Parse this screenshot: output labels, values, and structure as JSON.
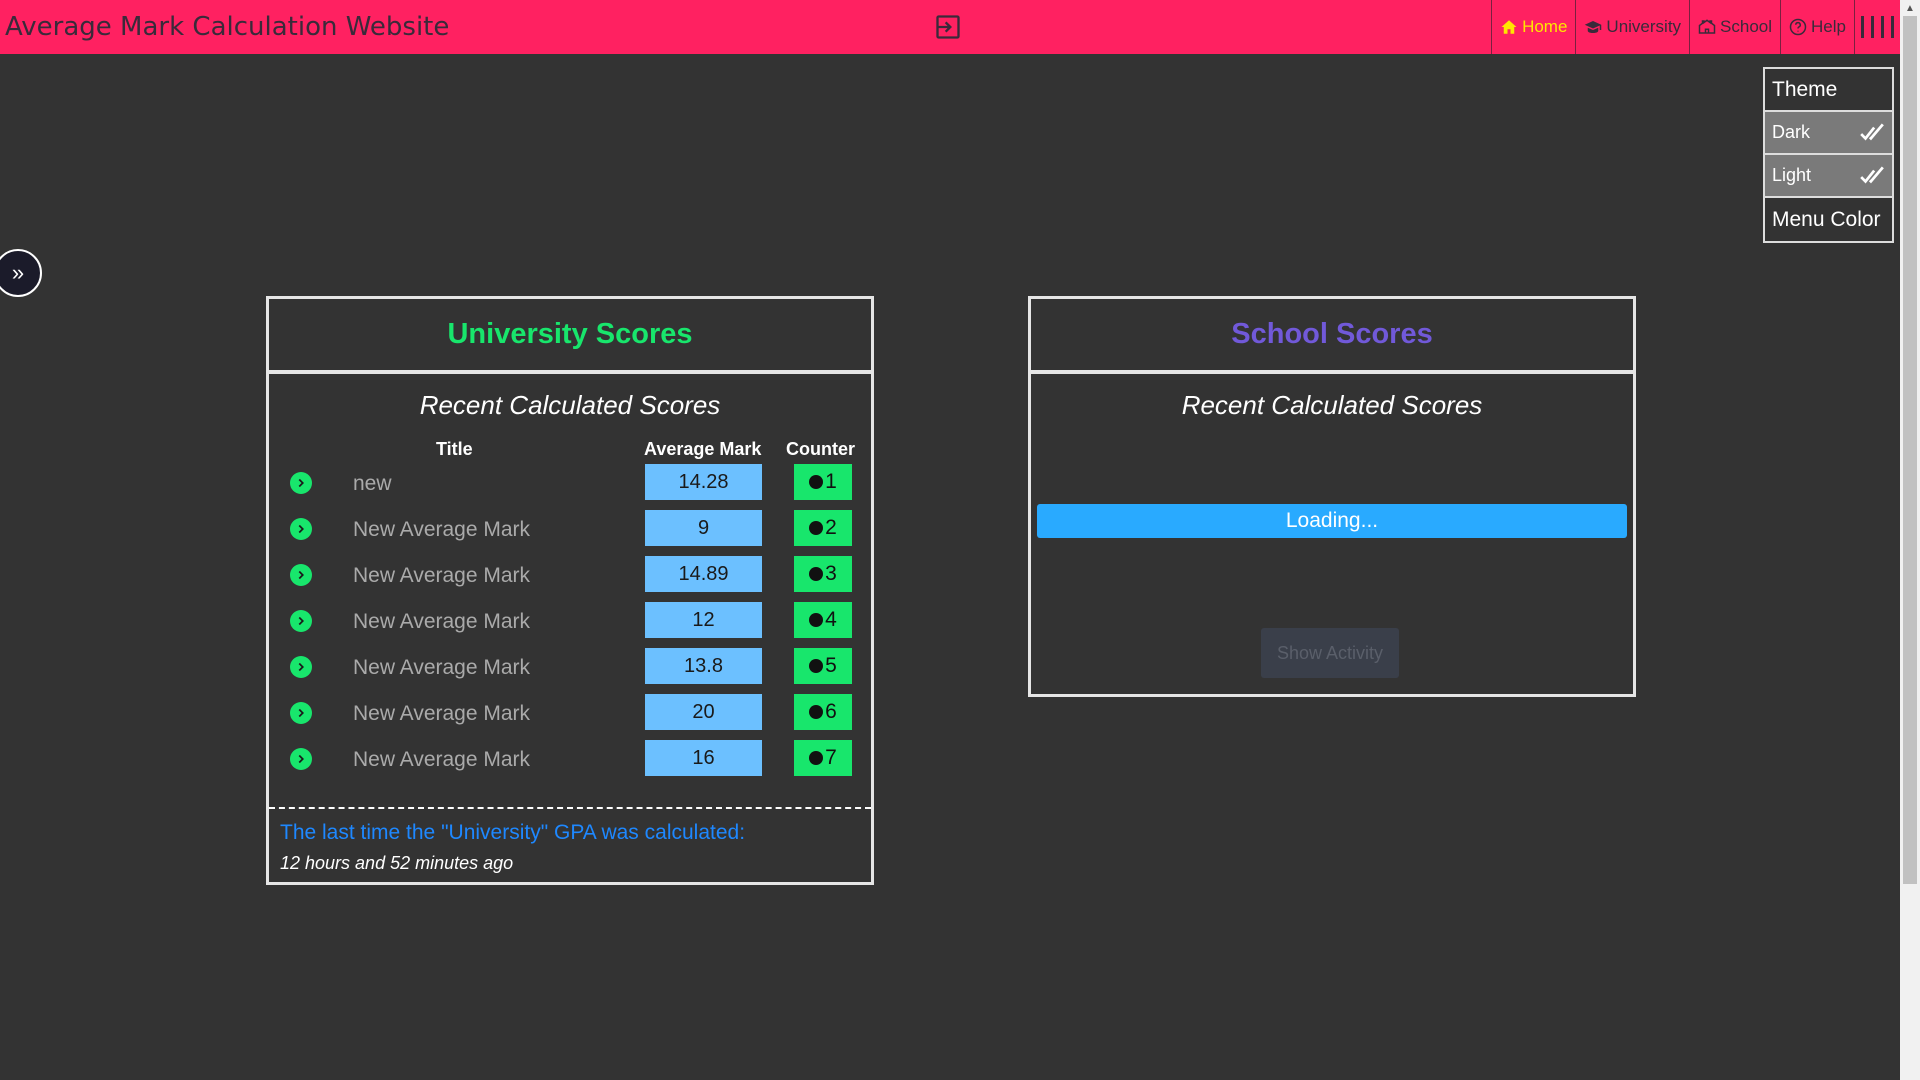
{
  "header": {
    "title": "Average Mark Calculation Website",
    "nav": [
      {
        "label": "Home",
        "icon": "home-icon",
        "active": true
      },
      {
        "label": "University",
        "icon": "graduation-cap-icon"
      },
      {
        "label": "School",
        "icon": "school-icon"
      },
      {
        "label": "Help",
        "icon": "help-icon"
      }
    ]
  },
  "theme_menu": {
    "title": "Theme",
    "options": [
      "Dark",
      "Light"
    ],
    "menu_color": "Menu Color"
  },
  "university": {
    "heading": "University Scores",
    "subtitle": "Recent Calculated Scores",
    "columns": {
      "title": "Title",
      "average": "Average Mark",
      "counter": "Counter"
    },
    "rows": [
      {
        "title": "new",
        "average": "14.28",
        "counter": "1"
      },
      {
        "title": "New Average Mark",
        "average": "9",
        "counter": "2"
      },
      {
        "title": "New Average Mark",
        "average": "14.89",
        "counter": "3"
      },
      {
        "title": "New Average Mark",
        "average": "12",
        "counter": "4"
      },
      {
        "title": "New Average Mark",
        "average": "13.8",
        "counter": "5"
      },
      {
        "title": "New Average Mark",
        "average": "20",
        "counter": "6"
      },
      {
        "title": "New Average Mark",
        "average": "16",
        "counter": "7"
      }
    ],
    "last_calc_label": "The last time the \"University\" GPA was calculated:",
    "last_calc_time": "12 hours and 52 minutes ago"
  },
  "school": {
    "heading": "School Scores",
    "subtitle": "Recent Calculated Scores",
    "loading": "Loading...",
    "show_activity": "Show Activity"
  },
  "colors": {
    "topbar": "#ff2161",
    "background": "#333333",
    "university_accent": "#18e66c",
    "school_accent": "#7159d9",
    "avg_badge": "#6cc0ff",
    "loading_bar": "#29aaff"
  }
}
